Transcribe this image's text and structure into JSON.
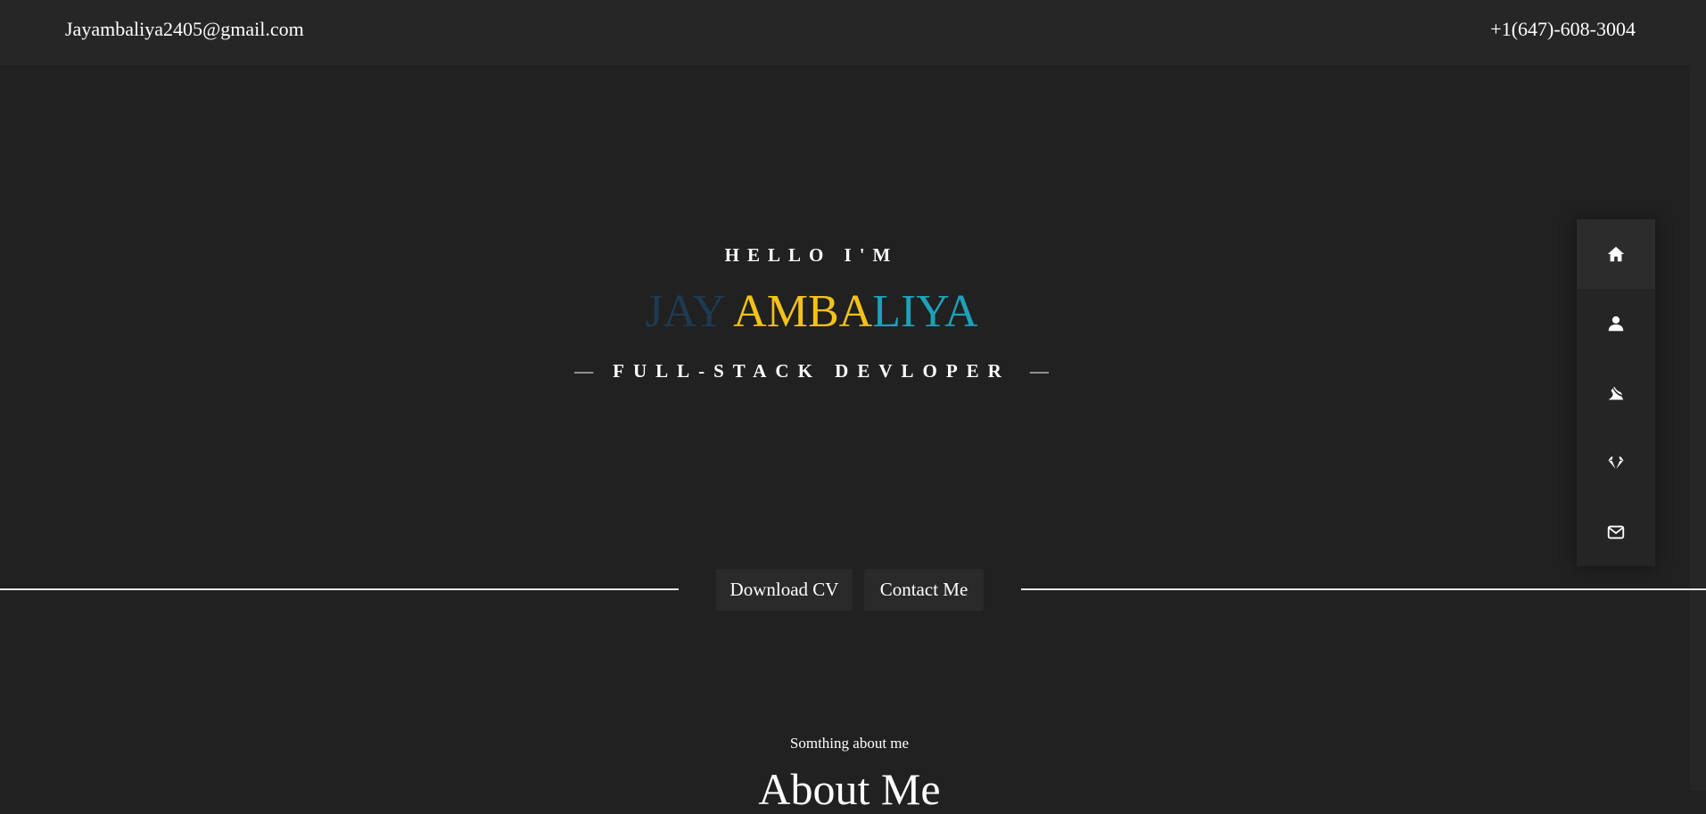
{
  "header": {
    "email": "Jayambaliya2405@gmail.com",
    "phone": "+1(647)-608-3004"
  },
  "hero": {
    "intro": "HELLO I'M",
    "name_parts": [
      "JAY",
      " AMBA",
      "LIYA"
    ],
    "role": "FULL-STACK DEVLOPER",
    "role_dash": "—"
  },
  "buttons": {
    "download_cv": "Download CV",
    "contact_me": "Contact Me"
  },
  "side_nav": {
    "items": [
      {
        "icon": "home-icon",
        "active": true
      },
      {
        "icon": "user-icon",
        "active": false
      },
      {
        "icon": "projects-icon",
        "active": false
      },
      {
        "icon": "diamond-icon",
        "active": false
      },
      {
        "icon": "envelope-icon",
        "active": false
      }
    ]
  },
  "about": {
    "subtitle": "Somthing about me",
    "title": "About Me"
  },
  "colors": {
    "background": "#212121",
    "topbar": "#262626",
    "name_dark": "#1d3a52",
    "name_yellow": "#f3c21a",
    "name_teal": "#1ea0b8"
  }
}
